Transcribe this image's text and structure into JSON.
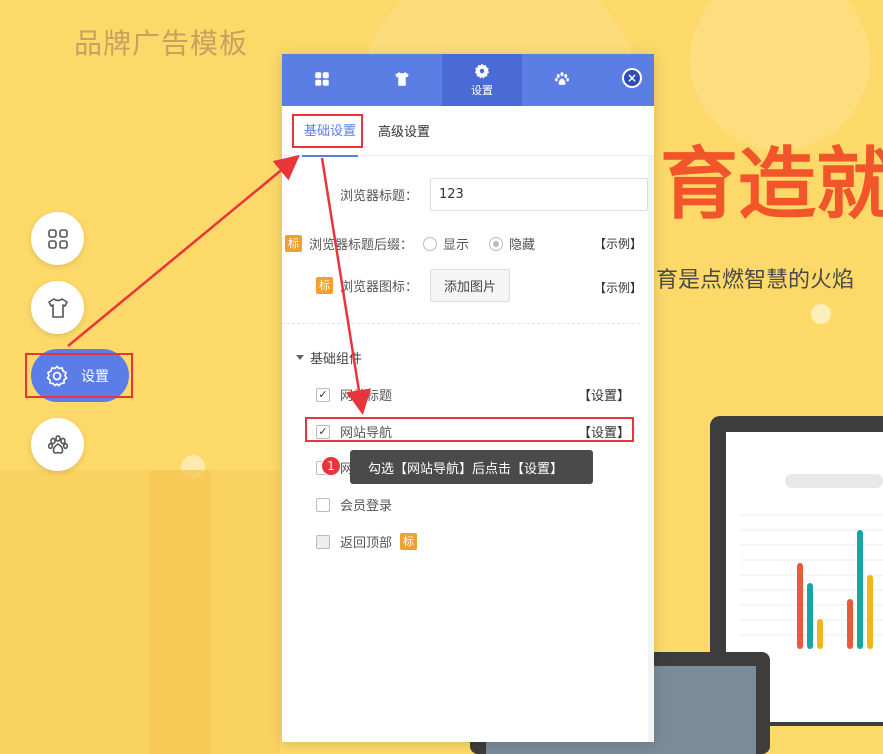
{
  "page": {
    "brand_title": "品牌广告模板",
    "hero_big": "育造就",
    "hero_sub": "育是点燃智慧的火焰"
  },
  "sidebar": {
    "items": [
      {
        "icon": "grid-icon"
      },
      {
        "icon": "tshirt-icon"
      },
      {
        "icon": "gear-icon",
        "label": "设置"
      },
      {
        "icon": "paw-icon"
      }
    ]
  },
  "panel": {
    "tabs": [
      {
        "icon": "grid-icon",
        "label": ""
      },
      {
        "icon": "tshirt-icon",
        "label": ""
      },
      {
        "icon": "gear-icon",
        "label": "设置"
      },
      {
        "icon": "paw-icon",
        "label": ""
      }
    ],
    "close_label": "×",
    "subtabs": [
      "基础设置",
      "高级设置"
    ],
    "browser_title": {
      "label": "浏览器标题：",
      "value": "123"
    },
    "title_suffix": {
      "badge": "标",
      "label": "浏览器标题后缀：",
      "option_show": "显示",
      "option_hide": "隐藏",
      "example": "【示例】"
    },
    "browser_icon": {
      "badge": "标",
      "label": "浏览器图标：",
      "button": "添加图片",
      "example": "【示例】"
    },
    "components": {
      "title": "基础组件",
      "items": [
        {
          "label": "网站标题",
          "checked": true,
          "link": "【设置】"
        },
        {
          "label": "网站导航",
          "checked": true,
          "link": "【设置】"
        },
        {
          "label": "网站...",
          "checked": false,
          "link": ""
        },
        {
          "label": "会员登录",
          "checked": false,
          "link": ""
        },
        {
          "label": "返回顶部",
          "checked": false,
          "badge": "标"
        }
      ]
    }
  },
  "tooltip": {
    "step": "1",
    "text": "勾选【网站导航】后点击【设置】"
  },
  "colors": {
    "accent": "#5b7ee5",
    "highlight": "#e8353b",
    "background": "#fdd96a"
  }
}
